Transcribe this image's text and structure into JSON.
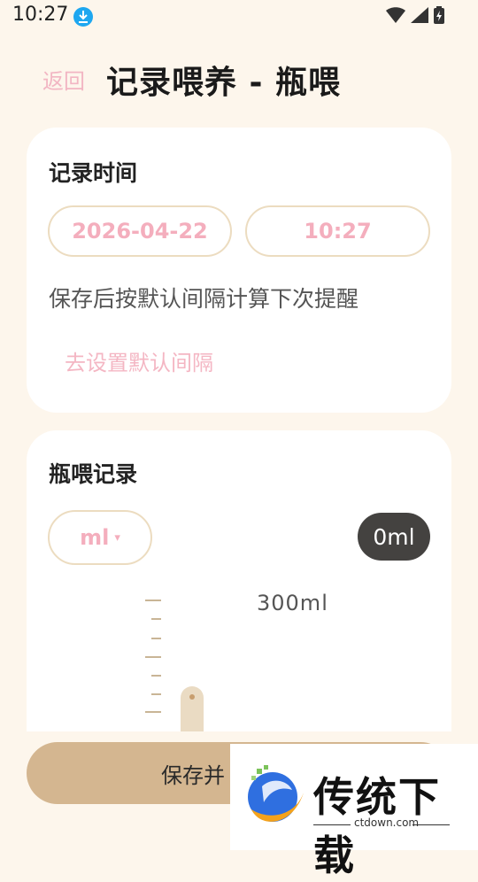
{
  "status_bar": {
    "time": "10:27"
  },
  "header": {
    "back_label": "返回",
    "title": "记录喂养 - 瓶喂"
  },
  "record_time": {
    "title": "记录时间",
    "date": "2026-04-22",
    "time": "10:27",
    "hint": "保存后按默认间隔计算下次提醒",
    "settings_link": "去设置默认间隔"
  },
  "bottle_record": {
    "title": "瓶喂记录",
    "unit": "ml",
    "unit_caret": "▾",
    "current_value": "0ml",
    "max_label": "300ml"
  },
  "save_button": {
    "label": "保存并"
  },
  "watermark": {
    "text": "传统下载",
    "domain": "ctdown.com"
  },
  "colors": {
    "background": "#fdf6ec",
    "accent_pink": "#f4aebd",
    "pill_border": "#ecdcc0",
    "save_button": "#d4b690",
    "badge_dark": "#444240"
  },
  "icons": [
    "download-icon",
    "wifi-icon",
    "signal-icon",
    "battery-icon",
    "caret-down-icon",
    "bottle-icon"
  ]
}
